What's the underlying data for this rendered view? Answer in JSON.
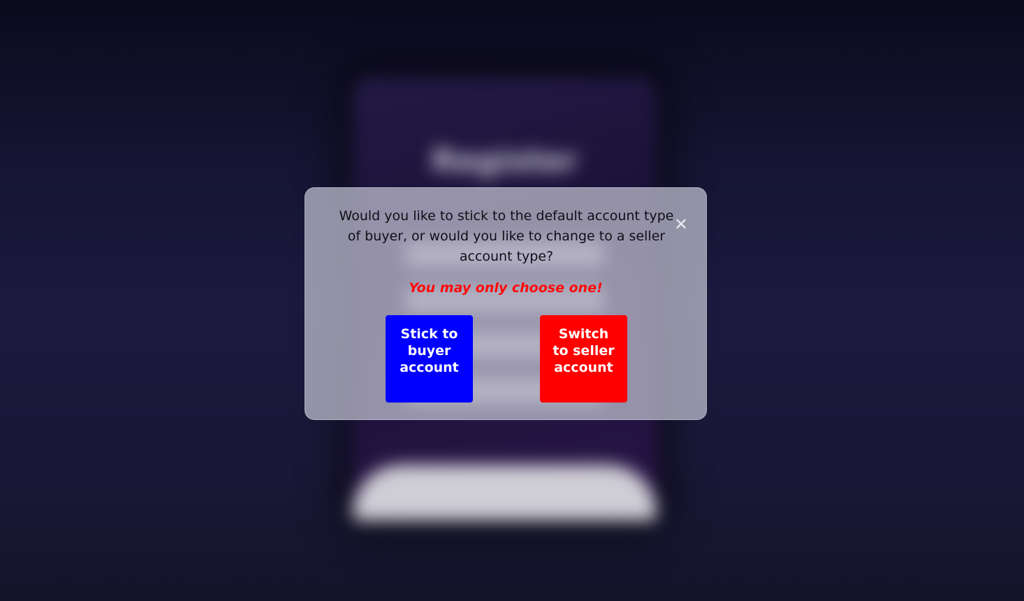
{
  "background": {
    "title": "Register",
    "colors": {
      "page_top": "#0b0a1c",
      "page_mid": "#1b1a3e",
      "card": "#1b1238"
    }
  },
  "modal": {
    "question": "Would you like to stick to the default account type of buyer, or would you like to change to a seller account type?",
    "close_icon": "close-icon",
    "close_symbol": "✕",
    "warning": "You may only choose one!",
    "buyer_button_label": "Stick to buyer account",
    "seller_button_label": "Switch to seller account",
    "colors": {
      "warning": "#ff0a0a",
      "buyer_button": "#0000ff",
      "seller_button": "#ff0000",
      "panel": "#b7b6c8"
    }
  }
}
